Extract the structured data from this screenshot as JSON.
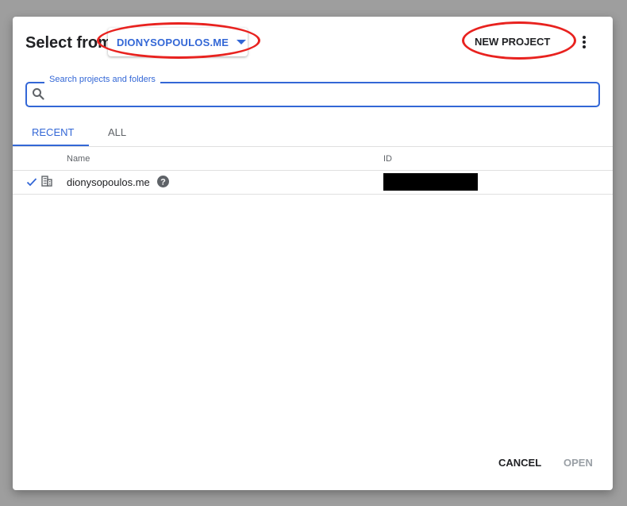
{
  "dialog": {
    "title": "Select from",
    "org_selector_label": "DIONYSOPOULOS.ME",
    "new_project_label": "NEW PROJECT",
    "more_icon": "more-vert-icon"
  },
  "search": {
    "label": "Search projects and folders",
    "value": "",
    "icon": "search-icon"
  },
  "tabs": [
    {
      "label": "RECENT",
      "active": true
    },
    {
      "label": "ALL",
      "active": false
    }
  ],
  "table": {
    "columns": [
      "Name",
      "ID"
    ],
    "rows": [
      {
        "selected": true,
        "icon": "organization-icon",
        "name": "dionysopoulos.me",
        "id": "",
        "id_redacted": true
      }
    ]
  },
  "footer": {
    "cancel_label": "CANCEL",
    "open_label": "OPEN",
    "open_enabled": false
  },
  "colors": {
    "accent": "#3367d6",
    "annotation_red": "#e8221f",
    "backdrop": "#9e9e9e",
    "disabled": "#9aa0a6"
  }
}
